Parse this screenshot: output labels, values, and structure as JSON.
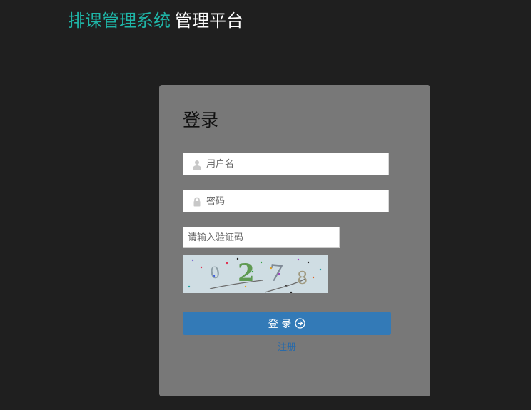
{
  "header": {
    "brand": "排课管理系统",
    "subtitle": "管理平台"
  },
  "login": {
    "title": "登录",
    "username_placeholder": "用户名",
    "password_placeholder": "密码",
    "captcha_placeholder": "请输入验证码",
    "captcha_text": "0278",
    "submit_label": "登 录",
    "register_label": "注册"
  },
  "colors": {
    "page_bg": "#1f1f1f",
    "brand": "#1fb5a7",
    "card_bg": "#787878",
    "button": "#337ab7",
    "link": "#2a6aa8"
  },
  "icons": {
    "username": "user-icon",
    "password": "lock-icon",
    "submit": "arrow-right-circle-icon"
  }
}
